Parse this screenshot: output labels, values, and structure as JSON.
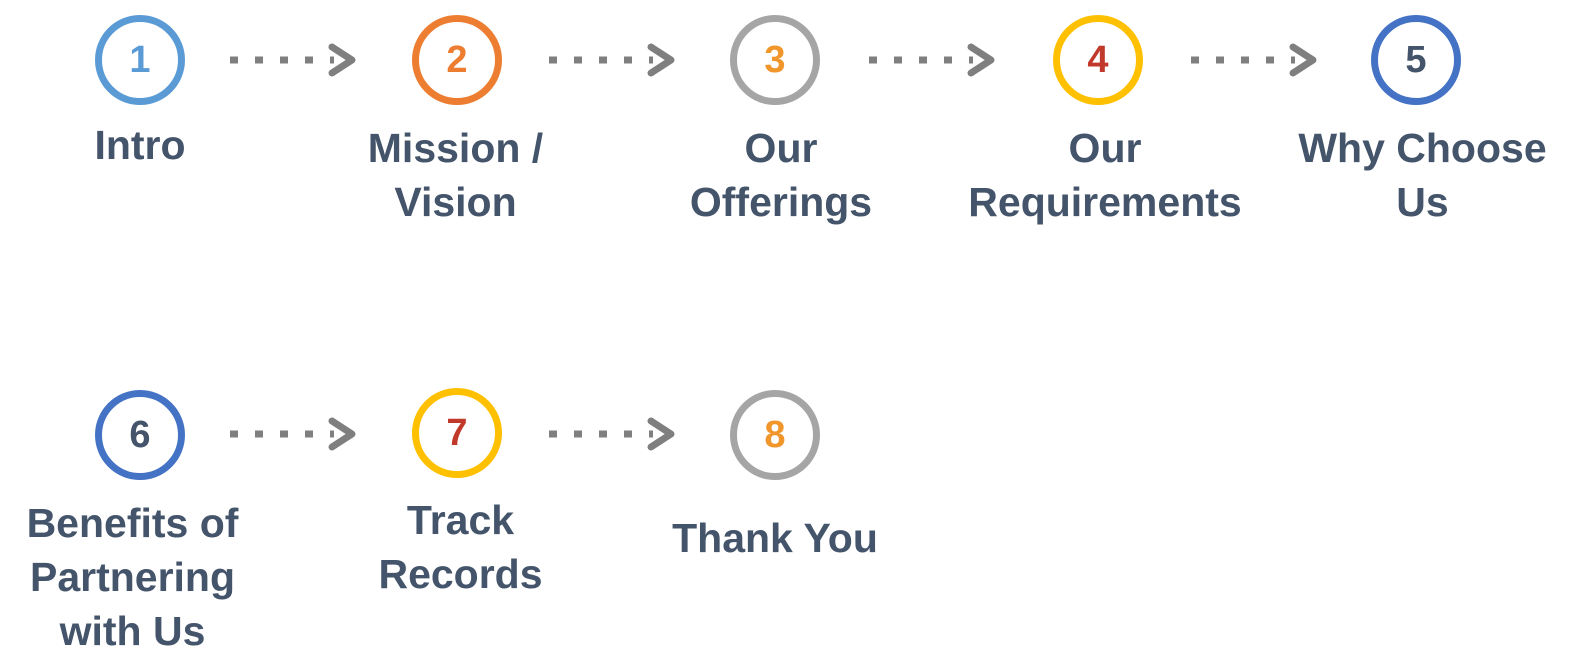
{
  "colors": {
    "label_text": "#44546a",
    "arrow": "#7f7f7f",
    "light_blue": "#5b9bd5",
    "orange": "#ed7d31",
    "gray": "#a5a5a5",
    "gold": "#ffc000",
    "blue": "#4472c4",
    "red": "#c0392b",
    "dark_orange": "#f0962a",
    "dark_blue": "#44546a"
  },
  "steps": [
    {
      "number": "1",
      "label": "Intro",
      "ring_color": "#5b9bd5",
      "number_color": "#5b9bd5"
    },
    {
      "number": "2",
      "label": "Mission / Vision",
      "ring_color": "#ed7d31",
      "number_color": "#ed7d31"
    },
    {
      "number": "3",
      "label": "Our Offerings",
      "ring_color": "#a5a5a5",
      "number_color": "#f0962a"
    },
    {
      "number": "4",
      "label": "Our Requirements",
      "ring_color": "#ffc000",
      "number_color": "#c0392b"
    },
    {
      "number": "5",
      "label": "Why Choose Us",
      "ring_color": "#4472c4",
      "number_color": "#44546a"
    },
    {
      "number": "6",
      "label": "Benefits of Partnering with Us",
      "ring_color": "#4472c4",
      "number_color": "#44546a"
    },
    {
      "number": "7",
      "label": "Track Records",
      "ring_color": "#ffc000",
      "number_color": "#c0392b"
    },
    {
      "number": "8",
      "label": "Thank You",
      "ring_color": "#a5a5a5",
      "number_color": "#f0962a"
    }
  ]
}
